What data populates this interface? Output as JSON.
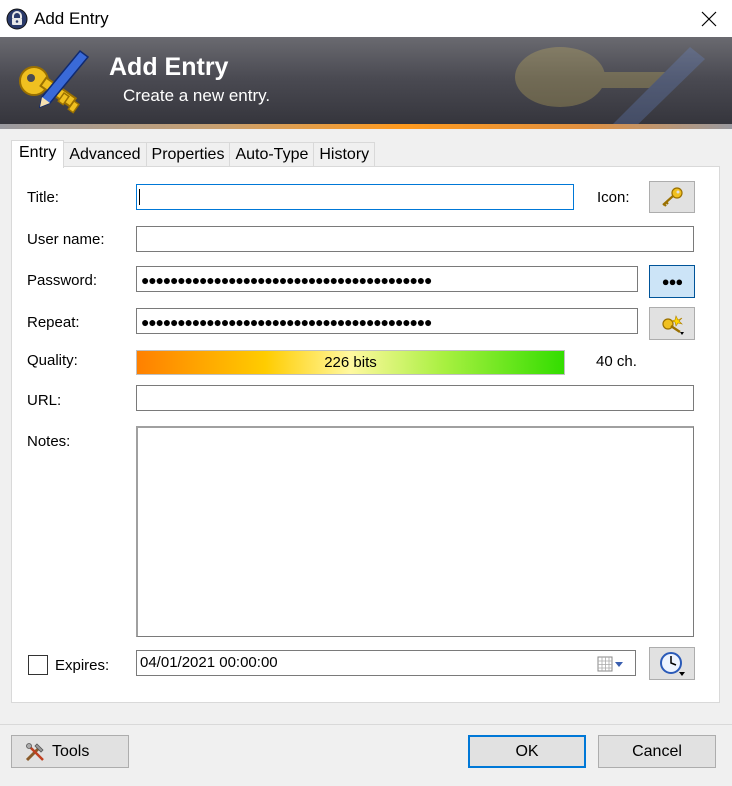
{
  "window": {
    "title": "Add Entry",
    "close_icon": "close-icon",
    "app_icon": "keepass-lock-icon"
  },
  "banner": {
    "title": "Add Entry",
    "subtitle": "Create a new entry.",
    "icon": "key-pen-icon"
  },
  "tabs": [
    {
      "label": "Entry",
      "active": true
    },
    {
      "label": "Advanced",
      "active": false
    },
    {
      "label": "Properties",
      "active": false
    },
    {
      "label": "Auto-Type",
      "active": false
    },
    {
      "label": "History",
      "active": false
    }
  ],
  "form": {
    "title_label": "Title:",
    "title_value": "",
    "icon_label": "Icon:",
    "username_label": "User name:",
    "username_value": "",
    "password_label": "Password:",
    "password_masked": "●●●●●●●●●●●●●●●●●●●●●●●●●●●●●●●●●●●●●●●●",
    "toggle_mask_label": "●●●",
    "repeat_label": "Repeat:",
    "repeat_masked": "●●●●●●●●●●●●●●●●●●●●●●●●●●●●●●●●●●●●●●●●",
    "quality_label": "Quality:",
    "quality_bits": "226 bits",
    "quality_fraction": 1.0,
    "char_count": "40 ch.",
    "url_label": "URL:",
    "url_value": "",
    "notes_label": "Notes:",
    "notes_value": "",
    "expires_label": "Expires:",
    "expires_checked": false,
    "expires_value": "04/01/2021 00:00:00"
  },
  "footer": {
    "tools_label": "Tools",
    "ok_label": "OK",
    "cancel_label": "Cancel"
  },
  "colors": {
    "accent": "#0078d7",
    "quality_low": "#ff8000",
    "quality_high": "#33dd00"
  }
}
